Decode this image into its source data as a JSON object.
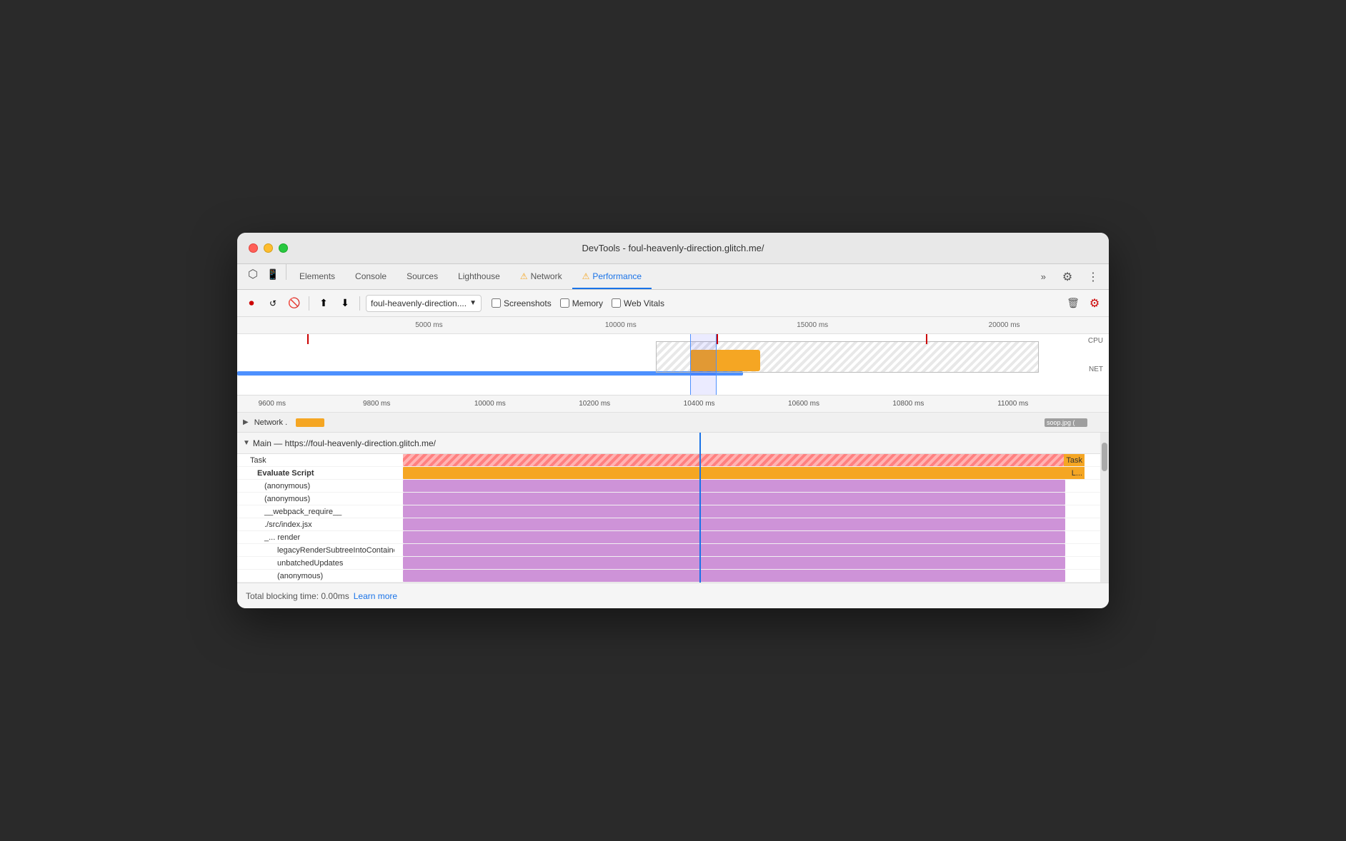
{
  "window": {
    "title": "DevTools - foul-heavenly-direction.glitch.me/"
  },
  "tabs": {
    "items": [
      {
        "id": "elements",
        "label": "Elements",
        "active": false,
        "warn": false
      },
      {
        "id": "console",
        "label": "Console",
        "active": false,
        "warn": false
      },
      {
        "id": "sources",
        "label": "Sources",
        "active": false,
        "warn": false
      },
      {
        "id": "lighthouse",
        "label": "Lighthouse",
        "active": false,
        "warn": false
      },
      {
        "id": "network",
        "label": "Network",
        "active": false,
        "warn": true
      },
      {
        "id": "performance",
        "label": "Performance",
        "active": true,
        "warn": true
      }
    ],
    "more_label": "»"
  },
  "perf_toolbar": {
    "url_value": "foul-heavenly-direction....",
    "screenshots_label": "Screenshots",
    "memory_label": "Memory",
    "web_vitals_label": "Web Vitals"
  },
  "timeline": {
    "ruler_marks": [
      "5000 ms",
      "10000 ms",
      "15000 ms",
      "20000 ms"
    ],
    "ruler_marks2": [
      "9600 ms",
      "9800 ms",
      "10000 ms",
      "10200 ms",
      "10400 ms",
      "10600 ms",
      "10800 ms",
      "11000 ms"
    ],
    "cpu_label": "CPU",
    "net_label": "NET",
    "network_label": "Network .",
    "soop_label": "soop.jpg ("
  },
  "main_section": {
    "header": "Main — https://foul-heavenly-direction.glitch.me/",
    "rows": [
      {
        "id": "task1",
        "label": "Task",
        "type": "task",
        "indent": 0
      },
      {
        "id": "evaluate",
        "label": "Evaluate Script",
        "type": "evaluate",
        "indent": 1
      },
      {
        "id": "anon1",
        "label": "(anonymous)",
        "type": "anon",
        "indent": 2
      },
      {
        "id": "anon2",
        "label": "(anonymous)",
        "type": "anon",
        "indent": 2
      },
      {
        "id": "webpack",
        "label": "__webpack_require__",
        "type": "anon",
        "indent": 2
      },
      {
        "id": "index",
        "label": "./src/index.jsx",
        "type": "anon",
        "indent": 2
      },
      {
        "id": "render",
        "label": "_...  render",
        "type": "anon",
        "indent": 2
      },
      {
        "id": "legacy",
        "label": "legacyRenderSubtreeIntoContainer",
        "type": "anon",
        "indent": 3
      },
      {
        "id": "unbatched",
        "label": "unbatchedUpdates",
        "type": "anon",
        "indent": 3
      },
      {
        "id": "anon3",
        "label": "(anonymous)",
        "type": "anon",
        "indent": 3
      }
    ]
  },
  "status_bar": {
    "blocking_time_label": "Total blocking time: 0.00ms",
    "learn_more_label": "Learn more"
  }
}
